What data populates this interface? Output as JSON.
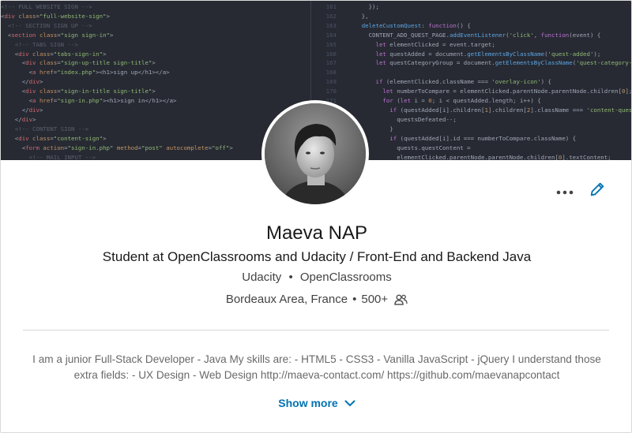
{
  "banner": {
    "left_code": [
      [
        [
          "c-cm",
          "<!-- FULL WEBSITE SIGN -->"
        ]
      ],
      [
        [
          "c-pl",
          "<"
        ],
        [
          "c-tag",
          "div"
        ],
        [
          "c-attr",
          " class"
        ],
        [
          "c-pl",
          "="
        ],
        [
          "c-str",
          "\"full-website-sign\""
        ],
        [
          "c-pl",
          ">"
        ]
      ],
      [
        [
          "c-pl",
          "  "
        ],
        [
          "c-cm",
          "<!-- SECTION SIGN UP -->"
        ]
      ],
      [
        [
          "c-pl",
          "  <"
        ],
        [
          "c-tag",
          "section"
        ],
        [
          "c-attr",
          " class"
        ],
        [
          "c-pl",
          "="
        ],
        [
          "c-str",
          "\"sign sign-in\""
        ],
        [
          "c-pl",
          ">"
        ]
      ],
      [
        [
          "c-pl",
          "    "
        ],
        [
          "c-cm",
          "<!-- TABS SIGN -->"
        ]
      ],
      [
        [
          "c-pl",
          "    <"
        ],
        [
          "c-tag",
          "div"
        ],
        [
          "c-attr",
          " class"
        ],
        [
          "c-pl",
          "="
        ],
        [
          "c-str",
          "\"tabs-sign-in\""
        ],
        [
          "c-pl",
          ">"
        ]
      ],
      [
        [
          "c-pl",
          "      <"
        ],
        [
          "c-tag",
          "div"
        ],
        [
          "c-attr",
          " class"
        ],
        [
          "c-pl",
          "="
        ],
        [
          "c-str",
          "\"sign-up-title sign-title\""
        ],
        [
          "c-pl",
          ">"
        ]
      ],
      [
        [
          "c-pl",
          "        <"
        ],
        [
          "c-tag",
          "a"
        ],
        [
          "c-attr",
          " href"
        ],
        [
          "c-pl",
          "="
        ],
        [
          "c-str",
          "\"index.php\""
        ],
        [
          "c-pl",
          "><h1>sign up</h1></a>"
        ]
      ],
      [
        [
          "c-pl",
          "      </"
        ],
        [
          "c-tag",
          "div"
        ],
        [
          "c-pl",
          ">"
        ]
      ],
      [
        [
          "c-pl",
          "      <"
        ],
        [
          "c-tag",
          "div"
        ],
        [
          "c-attr",
          " class"
        ],
        [
          "c-pl",
          "="
        ],
        [
          "c-str",
          "\"sign-in-title sign-title\""
        ],
        [
          "c-pl",
          ">"
        ]
      ],
      [
        [
          "c-pl",
          "        <"
        ],
        [
          "c-tag",
          "a"
        ],
        [
          "c-attr",
          " href"
        ],
        [
          "c-pl",
          "="
        ],
        [
          "c-str",
          "\"sign-in.php\""
        ],
        [
          "c-pl",
          "><h1>sign in</h1></a>"
        ]
      ],
      [
        [
          "c-pl",
          "      </"
        ],
        [
          "c-tag",
          "div"
        ],
        [
          "c-pl",
          ">"
        ]
      ],
      [
        [
          "c-pl",
          "    </"
        ],
        [
          "c-tag",
          "div"
        ],
        [
          "c-pl",
          ">"
        ]
      ],
      [
        [
          "c-pl",
          "    "
        ],
        [
          "c-cm",
          "<!-- CONTENT SIGN -->"
        ]
      ],
      [
        [
          "c-pl",
          "    <"
        ],
        [
          "c-tag",
          "div"
        ],
        [
          "c-attr",
          " class"
        ],
        [
          "c-pl",
          "="
        ],
        [
          "c-str",
          "\"content-sign\""
        ],
        [
          "c-pl",
          ">"
        ]
      ],
      [
        [
          "c-pl",
          "      <"
        ],
        [
          "c-tag",
          "form"
        ],
        [
          "c-attr",
          " action"
        ],
        [
          "c-pl",
          "="
        ],
        [
          "c-str",
          "\"sign-in.php\""
        ],
        [
          "c-attr",
          " method"
        ],
        [
          "c-pl",
          "="
        ],
        [
          "c-str",
          "\"post\""
        ],
        [
          "c-attr",
          " autocomplete"
        ],
        [
          "c-pl",
          "="
        ],
        [
          "c-str",
          "\"off\""
        ],
        [
          "c-pl",
          ">"
        ]
      ],
      [
        [
          "c-pl",
          "        "
        ],
        [
          "c-cm",
          "<!-- MAIL INPUT -->"
        ]
      ],
      [
        [
          "c-pl",
          "        <"
        ],
        [
          "c-tag",
          "div"
        ],
        [
          "c-attr",
          " class"
        ],
        [
          "c-pl",
          "="
        ],
        [
          "c-str",
          "\"mail-input sign-input\""
        ],
        [
          "c-pl",
          ">"
        ]
      ]
    ],
    "right_code": [
      [
        [
          "c-pl",
          "        });"
        ]
      ],
      [
        [
          "c-pl",
          "      },"
        ]
      ],
      [
        [
          "c-pl",
          "      "
        ],
        [
          "c-fn",
          "deleteCustomQuest"
        ],
        [
          "c-pl",
          ": "
        ],
        [
          "c-kw",
          "function"
        ],
        [
          "c-pl",
          "() {"
        ]
      ],
      [
        [
          "c-pl",
          "        CONTENT_ADD_QUEST_PAGE."
        ],
        [
          "c-fn",
          "addEventListener"
        ],
        [
          "c-pl",
          "("
        ],
        [
          "c-str",
          "'click'"
        ],
        [
          "c-pl",
          ", "
        ],
        [
          "c-kw",
          "function"
        ],
        [
          "c-pl",
          "(event) {"
        ]
      ],
      [
        [
          "c-pl",
          "          "
        ],
        [
          "c-kw",
          "let"
        ],
        [
          "c-pl",
          " elementClicked = event.target;"
        ]
      ],
      [
        [
          "c-pl",
          "          "
        ],
        [
          "c-kw",
          "let"
        ],
        [
          "c-pl",
          " questAdded = document."
        ],
        [
          "c-fn",
          "getElementsByClassName"
        ],
        [
          "c-pl",
          "("
        ],
        [
          "c-str",
          "'quest-added'"
        ],
        [
          "c-pl",
          ");"
        ]
      ],
      [
        [
          "c-pl",
          "          "
        ],
        [
          "c-kw",
          "let"
        ],
        [
          "c-pl",
          " questCategoryGroup = document."
        ],
        [
          "c-fn",
          "getElementsByClassName"
        ],
        [
          "c-pl",
          "("
        ],
        [
          "c-str",
          "'quest-category-group'"
        ],
        [
          "c-pl",
          ");"
        ]
      ],
      [
        [
          "c-pl",
          ""
        ]
      ],
      [
        [
          "c-pl",
          "          "
        ],
        [
          "c-kw",
          "if"
        ],
        [
          "c-pl",
          " (elementClicked.className === "
        ],
        [
          "c-str",
          "'overlay-icon'"
        ],
        [
          "c-pl",
          ") {"
        ]
      ],
      [
        [
          "c-pl",
          "            "
        ],
        [
          "c-kw",
          "let"
        ],
        [
          "c-pl",
          " numberToCompare = elementClicked.parentNode.parentNode.children["
        ],
        [
          "c-num",
          "0"
        ],
        [
          "c-pl",
          "];"
        ]
      ],
      [
        [
          "c-pl",
          "            "
        ],
        [
          "c-kw",
          "for"
        ],
        [
          "c-pl",
          " ("
        ],
        [
          "c-kw",
          "let"
        ],
        [
          "c-pl",
          " i = "
        ],
        [
          "c-num",
          "0"
        ],
        [
          "c-pl",
          "; i < questAdded.length; i++) {"
        ]
      ],
      [
        [
          "c-pl",
          "              "
        ],
        [
          "c-kw",
          "if"
        ],
        [
          "c-pl",
          " (questAdded[i].children["
        ],
        [
          "c-num",
          "1"
        ],
        [
          "c-pl",
          "].children["
        ],
        [
          "c-num",
          "2"
        ],
        [
          "c-pl",
          "].className === "
        ],
        [
          "c-str",
          "'content-quest-done'"
        ],
        [
          "c-pl",
          ") {"
        ]
      ],
      [
        [
          "c-pl",
          "                questsDefeated--;"
        ]
      ],
      [
        [
          "c-pl",
          "              }"
        ]
      ],
      [
        [
          "c-pl",
          "              "
        ],
        [
          "c-kw",
          "if"
        ],
        [
          "c-pl",
          " (questAdded[i].id === numberToCompare.className) {"
        ]
      ],
      [
        [
          "c-pl",
          "                quests.questContent = "
        ]
      ],
      [
        [
          "c-pl",
          "                elementClicked.parentNode.parentNode.children["
        ],
        [
          "c-num",
          "0"
        ],
        [
          "c-pl",
          "].textContent;"
        ]
      ],
      [
        [
          "c-pl",
          "                elementClicked.parentNode.parentNode."
        ],
        [
          "c-fn",
          "remove"
        ],
        [
          "c-pl",
          "();"
        ]
      ]
    ],
    "line_numbers": [
      "161",
      "162",
      "163",
      "164",
      "165",
      "166",
      "167",
      "168",
      "169",
      "170",
      "171",
      "172",
      "173",
      "174",
      "175",
      "176",
      "177",
      "178"
    ]
  },
  "profile": {
    "name": "Maeva NAP",
    "headline": "Student at OpenClassrooms and Udacity / Front-End and Backend Java",
    "company_1": "Udacity",
    "company_sep": "•",
    "company_2": "OpenClassrooms",
    "location": "Bordeaux Area, France",
    "location_sep": "•",
    "connections": "500+",
    "summary": "I am a junior Full-Stack Developer - Java My skills are: - HTML5 - CSS3 - Vanilla JavaScript - jQuery I understand those extra fields: - UX Design - Web Design http://maeva-contact.com/ https://github.com/maevanapcontact",
    "show_more_label": "Show more"
  },
  "icons": {
    "more": "more-horizontal-icon",
    "edit": "pencil-icon",
    "connections": "people-icon",
    "chevron": "chevron-down-icon"
  },
  "colors": {
    "link": "#0073b1",
    "banner_bg": "#272a33"
  }
}
